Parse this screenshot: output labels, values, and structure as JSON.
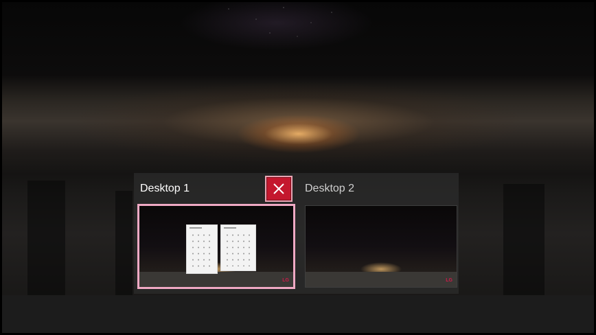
{
  "task_view": {
    "desktops": [
      {
        "label": "Desktop 1",
        "active": true,
        "close_label": "×"
      },
      {
        "label": "Desktop 2",
        "active": false
      }
    ]
  },
  "thumbnail_logo": "LG",
  "colors": {
    "active_border": "#f0a9c4",
    "close_button": "#c4182e",
    "band": "#2d2c2c"
  },
  "icons": {
    "close": "close-icon"
  }
}
